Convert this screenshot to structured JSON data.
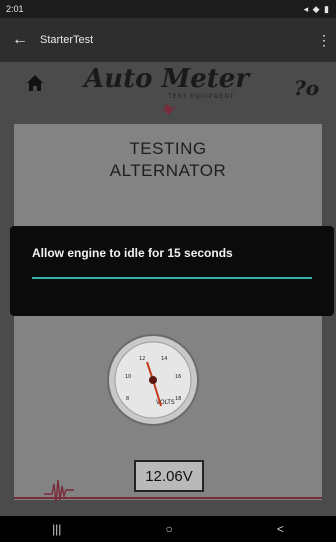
{
  "status_bar": {
    "time": "2:01",
    "icons_right": "◂ ◆ ▮"
  },
  "app_bar": {
    "back_icon": "arrow-left-icon",
    "title": "StarterTest",
    "menu_icon": "more-vert-icon"
  },
  "header": {
    "brand": "Auto Meter",
    "brand_sub": "TEST EQUIPMENT",
    "home_icon": "home-icon",
    "help_icon": "help-icon",
    "help_text": "?o"
  },
  "panel": {
    "title_line1": "TESTING",
    "title_line2": "ALTERNATOR"
  },
  "gauge": {
    "label": "VOLTS",
    "ticks": [
      "8",
      "10",
      "12",
      "14",
      "16",
      "18"
    ]
  },
  "reading": {
    "voltage": "12.06V"
  },
  "dialog": {
    "message": "Allow engine to idle for 15 seconds",
    "progress": 1.0
  },
  "nav_bar": {
    "recents": "|||",
    "home": "○",
    "back": "<"
  },
  "colors": {
    "accent": "#33b3a6",
    "brand_line": "#7a2b3a",
    "panel": "#838383"
  }
}
